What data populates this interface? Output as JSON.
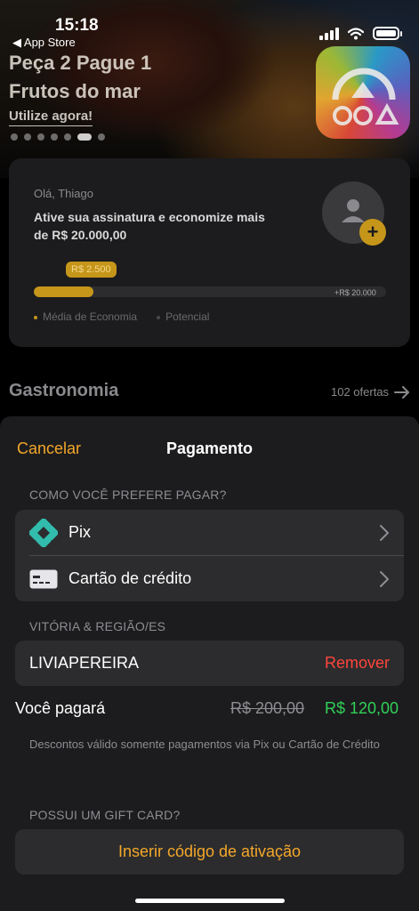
{
  "status_bar": {
    "time": "15:18",
    "back_label": "◀ App Store"
  },
  "promo": {
    "title": "Peça 2 Pague 1",
    "subtitle": "Frutos do mar",
    "cta": "Utilize agora!",
    "dots_total": 7,
    "active_dot": 5
  },
  "savings": {
    "greeting": "Olá, Thiago",
    "headline": "Ative sua assinatura e economize mais de  R$ 20.000,00",
    "progress_label": "R$ 2.500",
    "progress_max": "+R$ 20.000",
    "progress_fraction": 0.17,
    "legend_avg": "Média de Economia",
    "legend_potential": "Potencial",
    "add_symbol": "+"
  },
  "section": {
    "title": "Gastronomia",
    "count": "102 ofertas"
  },
  "sheet": {
    "cancel": "Cancelar",
    "title": "Pagamento",
    "payment_group_label": "COMO VOCÊ PREFERE PAGAR?",
    "methods": [
      {
        "label": "Pix",
        "icon": "pix-icon"
      },
      {
        "label": "Cartão de crédito",
        "icon": "credit-card-icon"
      }
    ],
    "coupon_group_label": "VITÓRIA & REGIÃO/ES",
    "coupon_code": "LIVIAPEREIRA",
    "remove_label": "Remover",
    "pay_label": "Você pagará",
    "old_price": "R$ 200,00",
    "new_price": "R$ 120,00",
    "note": "Descontos válido somente pagamentos via Pix ou Cartão de Crédito",
    "gift_label": "POSSUI UM GIFT CARD?",
    "activate_label": "Inserir código de ativação"
  },
  "colors": {
    "accent_orange": "#f4a72a",
    "gold": "#c6961a",
    "remove_red": "#ff453a",
    "price_green": "#30d158",
    "pix_teal": "#32bcad"
  }
}
